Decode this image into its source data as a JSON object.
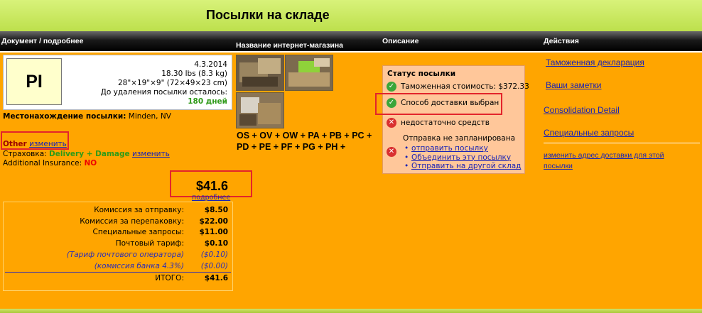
{
  "page": {
    "title": "Посылки на складе"
  },
  "columns": {
    "document": "Документ / подробнее",
    "shop": "Название интернет-магазина",
    "description": "Описание",
    "actions": "Действия"
  },
  "parcel": {
    "logo_text": "PI",
    "date": "4.3.2014",
    "weight": "18.30 lbs (8.3 kg)",
    "dimensions": "28\"×19\"×9\" (72×49×23 cm)",
    "removal_label": "До удаления посылки осталось:",
    "removal_days": "180 дней",
    "location_label": "Местонахождение посылки:",
    "location_value": "Minden, NV",
    "shipping_method": "Other",
    "change_link": "изменить",
    "insurance_label": "Страховка:",
    "insurance_value": "Delivery + Damage",
    "insurance_change": "изменить",
    "additional_insurance_label": "Additional Insurance:",
    "additional_insurance_value": "NO",
    "total": "$41.6",
    "details_link": "подробнее"
  },
  "fees": [
    {
      "label": "Комиссия за отправку:",
      "value": "$8.50",
      "italic": false
    },
    {
      "label": "Комиссия за перепаковку:",
      "value": "$22.00",
      "italic": false
    },
    {
      "label": "Специальные запросы:",
      "value": "$11.00",
      "italic": false
    },
    {
      "label": "Почтовый тариф:",
      "value": "$0.10",
      "italic": false
    },
    {
      "label": "(Тариф почтового оператора)",
      "value": "($0.10)",
      "italic": true
    },
    {
      "label": "(комиссия банка 4.3%)",
      "value": "($0.00)",
      "italic": true
    },
    {
      "label": "ИТОГО:",
      "value": "$41.6",
      "italic": false
    }
  ],
  "shop": {
    "codes": "OS + OV + OW + PA + PB + PC + PD + PE + PF + PG + PH +"
  },
  "status": {
    "title": "Статус посылки",
    "customs_value": "Таможенная стоимость: $372.33",
    "delivery_selected": "Способ доставки выбран",
    "insufficient_funds": "недостаточно средств",
    "not_scheduled": "Отправка не запланирована",
    "links": [
      "отправить посылку",
      "Объединить эту посылку",
      "Отправить на другой склад"
    ]
  },
  "actions": {
    "customs_declaration": "Таможенная декларация",
    "your_notes": "Ваши заметки",
    "consolidation_detail": "Consolidation Detail",
    "special_requests": "Специальные запросы",
    "change_address": "изменить адрес доставки для этой посылки"
  },
  "colors": {
    "background": "#ffa500",
    "title_bar": "#c8e65a",
    "link": "#1a23b5",
    "highlight_red": "#e3242b",
    "status_panel": "#ffc79a",
    "ok_green": "#3aa63a",
    "error_red": "#d93030"
  }
}
